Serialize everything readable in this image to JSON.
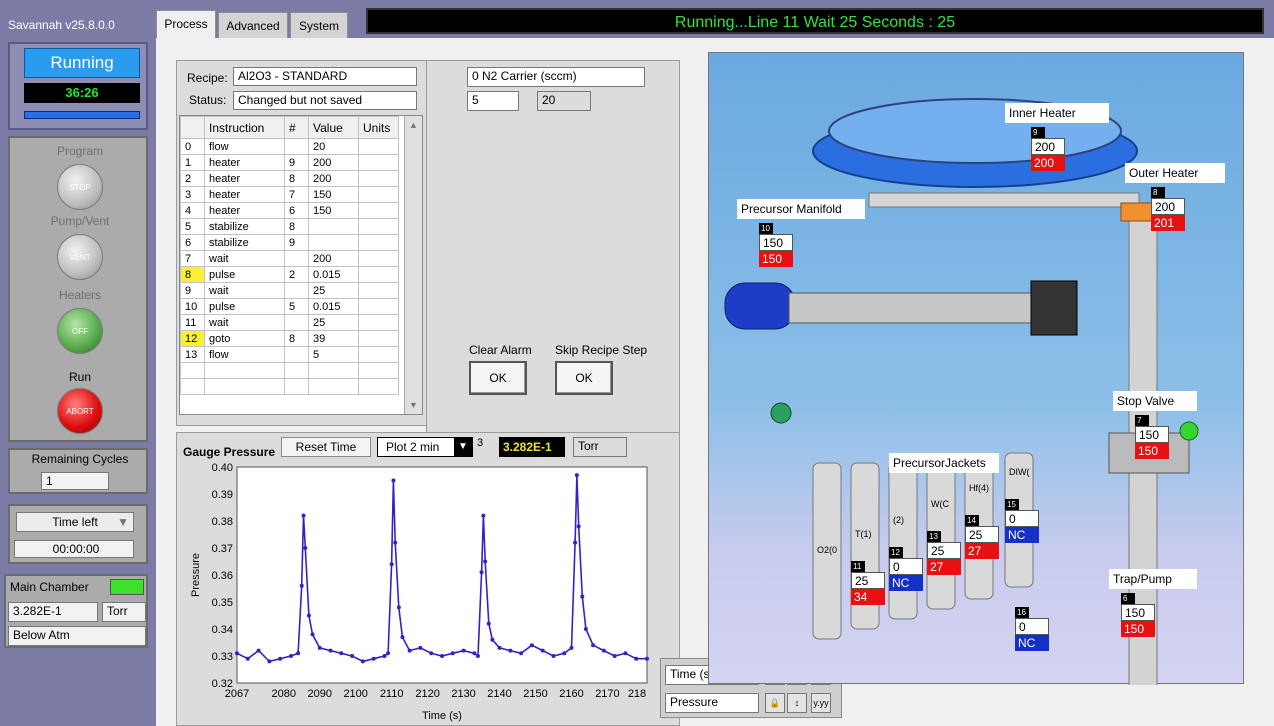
{
  "app": {
    "title": "Savannah v25.8.0.0"
  },
  "status_bar": {
    "text": "Running...Line 11 Wait 25 Seconds : 25"
  },
  "tabs": [
    {
      "label": "Process"
    },
    {
      "label": "Advanced"
    },
    {
      "label": "System"
    }
  ],
  "left": {
    "run_state": "Running",
    "run_timer": "36:26",
    "program_label": "Program",
    "stop_label": "STOP",
    "pump_vent_label": "Pump/Vent",
    "vent_label": "VENT",
    "heaters_label": "Heaters",
    "off_label": "OFF",
    "run_label": "Run",
    "abort_label": "ABORT",
    "remaining_cycles_label": "Remaining Cycles",
    "remaining_cycles_value": "1",
    "time_left_label": "Time left",
    "time_left_value": "00:00:00",
    "main_chamber_label": "Main Chamber",
    "pressure_value": "3.282E-1",
    "pressure_unit": "Torr",
    "pressure_state": "Below Atm"
  },
  "recipe": {
    "recipe_label": "Recipe:",
    "recipe_value": "Al2O3 - STANDARD",
    "status_label": "Status:",
    "status_value": "Changed but not saved",
    "columns": [
      "",
      "Instruction",
      "#",
      "Value",
      "Units"
    ],
    "rows": [
      {
        "n": "0",
        "instr": "flow",
        "num": "",
        "val": "20",
        "units": ""
      },
      {
        "n": "1",
        "instr": "heater",
        "num": "9",
        "val": "200",
        "units": ""
      },
      {
        "n": "2",
        "instr": "heater",
        "num": "8",
        "val": "200",
        "units": ""
      },
      {
        "n": "3",
        "instr": "heater",
        "num": "7",
        "val": "150",
        "units": ""
      },
      {
        "n": "4",
        "instr": "heater",
        "num": "6",
        "val": "150",
        "units": ""
      },
      {
        "n": "5",
        "instr": "stabilize",
        "num": "8",
        "val": "",
        "units": ""
      },
      {
        "n": "6",
        "instr": "stabilize",
        "num": "9",
        "val": "",
        "units": ""
      },
      {
        "n": "7",
        "instr": "wait",
        "num": "",
        "val": "200",
        "units": ""
      },
      {
        "n": "8",
        "instr": "pulse",
        "num": "2",
        "val": "0.015",
        "units": ""
      },
      {
        "n": "9",
        "instr": "wait",
        "num": "",
        "val": "25",
        "units": ""
      },
      {
        "n": "10",
        "instr": "pulse",
        "num": "5",
        "val": "0.015",
        "units": ""
      },
      {
        "n": "11",
        "instr": "wait",
        "num": "",
        "val": "25",
        "units": ""
      },
      {
        "n": "12",
        "instr": "goto",
        "num": "8",
        "val": "39",
        "units": ""
      },
      {
        "n": "13",
        "instr": "flow",
        "num": "",
        "val": "5",
        "units": ""
      }
    ]
  },
  "flow": {
    "carrier_label": "0 N2 Carrier (sccm)",
    "setpoint": "5",
    "reading": "20",
    "clear_alarm_label": "Clear Alarm",
    "skip_step_label": "Skip Recipe Step",
    "ok_label": "OK"
  },
  "gauge": {
    "title": "Gauge Pressure",
    "reset_label": "Reset  Time",
    "plot_option": "Plot 2 min",
    "digits": "3",
    "value": "3.282E-1",
    "unit": "Torr",
    "time_field": "Time (s)",
    "pressure_field": "Pressure"
  },
  "chart_data": {
    "type": "line",
    "title": "",
    "xlabel": "Time (s)",
    "ylabel": "Pressure",
    "xlim": [
      2067,
      2181
    ],
    "ylim": [
      0.32,
      0.4
    ],
    "xticks": [
      "2067",
      "2080",
      "2090",
      "2100",
      "2110",
      "2120",
      "2130",
      "2140",
      "2150",
      "2160",
      "2170",
      "218"
    ],
    "yticks": [
      "0.40",
      "0.39",
      "0.38",
      "0.37",
      "0.36",
      "0.35",
      "0.34",
      "0.33",
      "0.32"
    ],
    "grid": false,
    "color": "#3a1fc4",
    "x": [
      2067,
      2070,
      2073,
      2076,
      2079,
      2082,
      2084,
      2085,
      2085.5,
      2086,
      2087,
      2088,
      2090,
      2093,
      2096,
      2099,
      2102,
      2105,
      2108,
      2109,
      2110,
      2110.5,
      2111,
      2112,
      2113,
      2115,
      2118,
      2121,
      2124,
      2127,
      2130,
      2133,
      2134,
      2135,
      2135.5,
      2136,
      2137,
      2138,
      2140,
      2143,
      2146,
      2149,
      2152,
      2155,
      2158,
      2160,
      2161,
      2161.5,
      2162,
      2163,
      2164,
      2166,
      2169,
      2172,
      2175,
      2178,
      2181
    ],
    "y": [
      0.331,
      0.329,
      0.332,
      0.328,
      0.329,
      0.33,
      0.331,
      0.356,
      0.382,
      0.37,
      0.345,
      0.338,
      0.333,
      0.332,
      0.331,
      0.33,
      0.328,
      0.329,
      0.33,
      0.331,
      0.364,
      0.395,
      0.372,
      0.348,
      0.337,
      0.332,
      0.333,
      0.331,
      0.33,
      0.331,
      0.332,
      0.331,
      0.33,
      0.361,
      0.382,
      0.365,
      0.342,
      0.336,
      0.333,
      0.332,
      0.331,
      0.334,
      0.332,
      0.33,
      0.331,
      0.333,
      0.372,
      0.397,
      0.378,
      0.352,
      0.34,
      0.334,
      0.332,
      0.33,
      0.331,
      0.329,
      0.329
    ]
  },
  "scene": {
    "inner_heater_label": "Inner Heater",
    "outer_heater_label": "Outer Heater",
    "precursor_manifold_label": "Precursor Manifold",
    "precursor_jackets_label": "PrecursorJackets",
    "stop_valve_label": "Stop Valve",
    "trap_pump_label": "Trap/Pump",
    "bottle_labels": [
      "O2(0",
      "T(1)",
      "(2)",
      "W(C",
      "Hf(4)",
      "DIW("
    ],
    "gauges": {
      "inner": {
        "id": "9",
        "set": "200",
        "read": "200"
      },
      "outer": {
        "id": "8",
        "set": "200",
        "read": "201"
      },
      "manifold": {
        "id": "10",
        "set": "150",
        "read": "150"
      },
      "stop_valve": {
        "id": "7",
        "set": "150",
        "read": "150"
      },
      "trap": {
        "id": "6",
        "set": "150",
        "read": "150"
      },
      "jacket11": {
        "id": "11",
        "set": "25",
        "read": "34"
      },
      "jacket12": {
        "id": "12",
        "set": "0",
        "read": "NC"
      },
      "jacket13": {
        "id": "13",
        "set": "25",
        "read": "27"
      },
      "jacket14": {
        "id": "14",
        "set": "25",
        "read": "27"
      },
      "jacket15": {
        "id": "15",
        "set": "0",
        "read": "NC"
      },
      "extra16": {
        "id": "16",
        "set": "0",
        "read": "NC"
      }
    }
  },
  "colors": {
    "running": "#2a9cf0",
    "status_green": "#32e23a",
    "alarm_red": "#e81010",
    "nc_blue": "#1530c8",
    "highlight": "#f8f035"
  }
}
